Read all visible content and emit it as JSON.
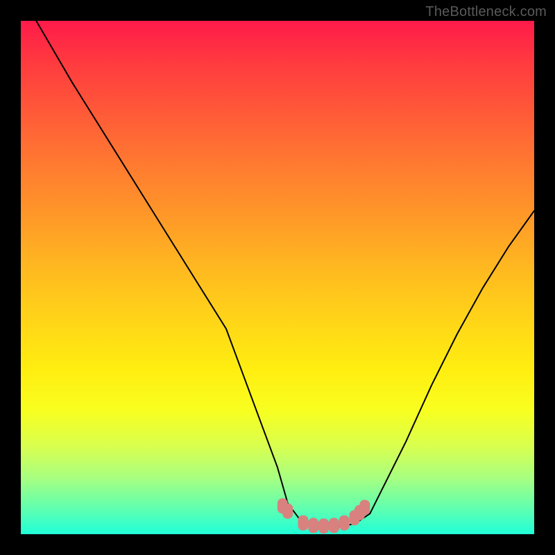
{
  "watermark": "TheBottleneck.com",
  "chart_data": {
    "type": "line",
    "title": "",
    "xlabel": "",
    "ylabel": "",
    "xlim": [
      0,
      100
    ],
    "ylim": [
      0,
      100
    ],
    "series": [
      {
        "name": "curve",
        "x": [
          3,
          10,
          20,
          30,
          40,
          50,
          52,
          55,
          58,
          62,
          65,
          68,
          70,
          75,
          80,
          85,
          90,
          95,
          100
        ],
        "values": [
          100,
          88,
          72,
          56,
          40,
          13,
          6,
          2,
          1.5,
          1.5,
          2,
          4,
          8,
          18,
          29,
          39,
          48,
          56,
          63
        ],
        "color": "#000000"
      }
    ],
    "highlight": {
      "name": "optimum-band",
      "color": "#d8817f",
      "points": [
        {
          "x": 51,
          "y": 5.5
        },
        {
          "x": 52,
          "y": 4.5
        },
        {
          "x": 55,
          "y": 2.2
        },
        {
          "x": 57,
          "y": 1.7
        },
        {
          "x": 59,
          "y": 1.6
        },
        {
          "x": 61,
          "y": 1.7
        },
        {
          "x": 63,
          "y": 2.2
        },
        {
          "x": 65,
          "y": 3.2
        },
        {
          "x": 66,
          "y": 4.2
        },
        {
          "x": 67,
          "y": 5.2
        }
      ]
    },
    "grid": false
  }
}
